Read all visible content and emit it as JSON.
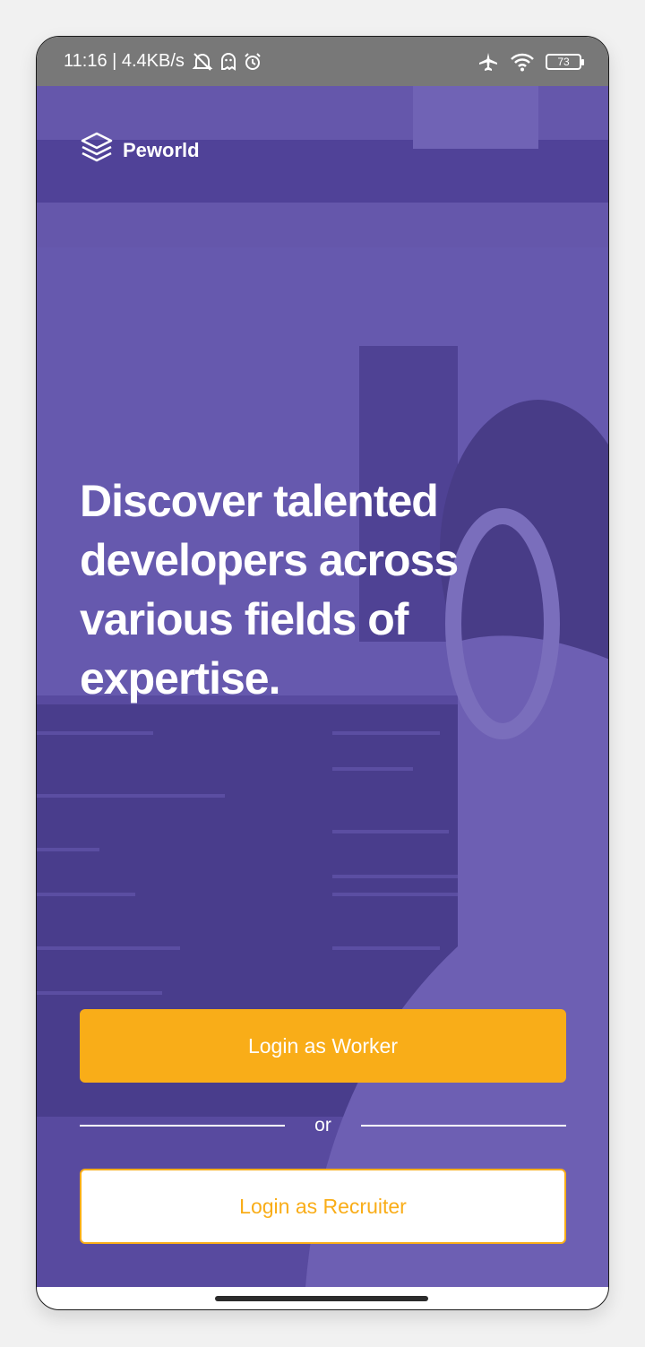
{
  "status_bar": {
    "time_speed": "11:16 | 4.4KB/s",
    "battery_level": "73",
    "icons": [
      "mute-icon",
      "ghost-icon",
      "alarm-icon",
      "airplane-icon",
      "wifi-icon",
      "battery-icon"
    ]
  },
  "brand": {
    "name": "Peworld",
    "icon": "layers-icon"
  },
  "hero": {
    "headline": "Discover talented developers across various fields of expertise."
  },
  "actions": {
    "worker_label": "Login as Worker",
    "divider_text": "or",
    "recruiter_label": "Login as Recruiter"
  },
  "colors": {
    "accent": "#f9ad18",
    "overlay": "#6052ac",
    "status_bar": "#787878"
  }
}
